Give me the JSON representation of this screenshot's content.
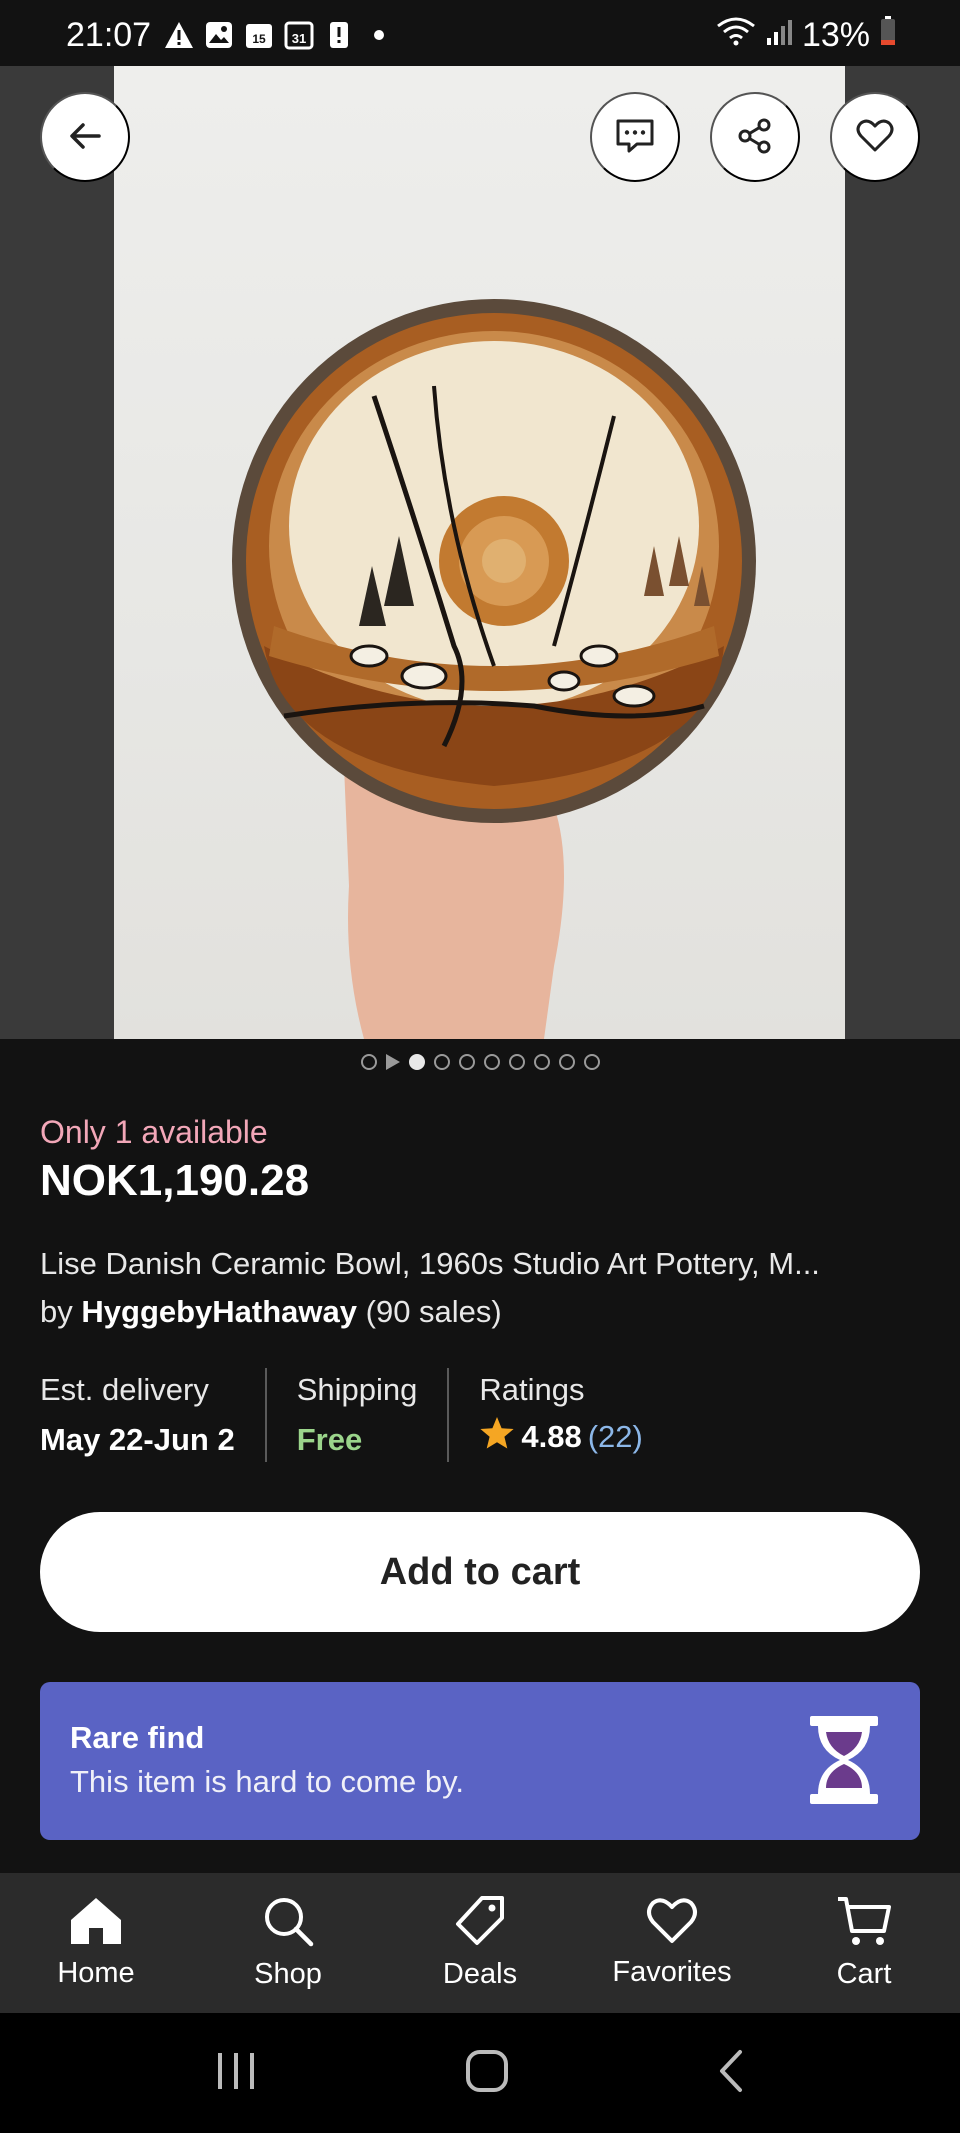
{
  "status_bar": {
    "time": "21:07",
    "battery": "13%",
    "notification_icons": [
      "warning-icon",
      "image-icon",
      "calendar-15-icon",
      "calendar-31-icon",
      "alert-icon",
      "dot-icon"
    ]
  },
  "product": {
    "availability": "Only 1 available",
    "price": "NOK1,190.28",
    "title": "Lise Danish Ceramic Bowl, 1960s Studio Art Pottery, M...",
    "seller_prefix": "by",
    "seller_name": "HyggebyHathaway",
    "seller_sales": "(90 sales)"
  },
  "gallery": {
    "total_images": 10,
    "active_index": 0
  },
  "info": {
    "delivery_label": "Est. delivery",
    "delivery_value": "May 22-Jun 2",
    "shipping_label": "Shipping",
    "shipping_value": "Free",
    "ratings_label": "Ratings",
    "rating_value": "4.88",
    "rating_count": "(22)"
  },
  "actions": {
    "add_to_cart": "Add to cart"
  },
  "rare_find": {
    "title": "Rare find",
    "text": "This item is hard to come by."
  },
  "bottom_nav": {
    "items": [
      {
        "label": "Home",
        "icon": "home-icon"
      },
      {
        "label": "Shop",
        "icon": "search-icon"
      },
      {
        "label": "Deals",
        "icon": "tag-icon"
      },
      {
        "label": "Favorites",
        "icon": "heart-icon"
      },
      {
        "label": "Cart",
        "icon": "cart-icon"
      }
    ]
  },
  "colors": {
    "background": "#121212",
    "availability": "#f2a7b8",
    "free": "#9bd58b",
    "rating_count": "#8cb7e8",
    "rare_banner": "#5a63c4",
    "star": "#f5a623"
  }
}
